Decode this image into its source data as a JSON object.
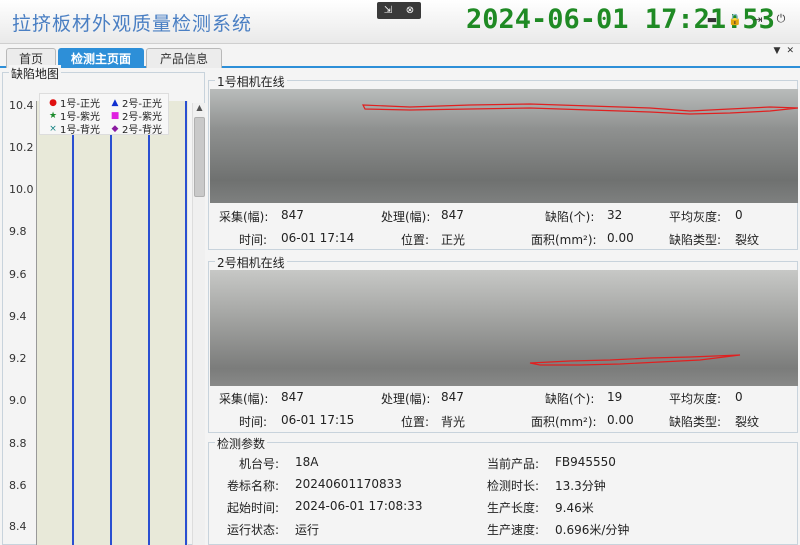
{
  "app": {
    "title": "拉挤板材外观质量检测系统",
    "clock": "2024-06-01 17:21:53"
  },
  "tabs": [
    {
      "label": "首页",
      "active": false
    },
    {
      "label": "检测主页面",
      "active": true
    },
    {
      "label": "产品信息",
      "active": false
    }
  ],
  "defect_map": {
    "title": "缺陷地图",
    "y_ticks": [
      "10.4",
      "10.2",
      "10.0",
      "9.8",
      "9.6",
      "9.4",
      "9.2",
      "9.0",
      "8.8",
      "8.6",
      "8.4"
    ],
    "legend": [
      {
        "label": "1号-正光",
        "marker": "●",
        "color": "#e01010"
      },
      {
        "label": "2号-正光",
        "marker": "▲",
        "color": "#1030d0"
      },
      {
        "label": "1号-紫光",
        "marker": "★",
        "color": "#1a8a2a"
      },
      {
        "label": "2号-紫光",
        "marker": "■",
        "color": "#e020e0"
      },
      {
        "label": "1号-背光",
        "marker": "×",
        "color": "#108080"
      },
      {
        "label": "2号-背光",
        "marker": "◆",
        "color": "#8a1aa0"
      }
    ]
  },
  "camera1": {
    "title": "1号相机在线",
    "collect_label": "采集(幅):",
    "collect_value": "847",
    "process_label": "处理(幅):",
    "process_value": "847",
    "defect_label": "缺陷(个):",
    "defect_value": "32",
    "gray_label": "平均灰度:",
    "gray_value": "0",
    "time_label": "时间:",
    "time_value": "06-01 17:14",
    "pos_label": "位置:",
    "pos_value": "正光",
    "area_label": "面积(mm²):",
    "area_value": "0.00",
    "type_label": "缺陷类型:",
    "type_value": "裂纹"
  },
  "camera2": {
    "title": "2号相机在线",
    "collect_label": "采集(幅):",
    "collect_value": "847",
    "process_label": "处理(幅):",
    "process_value": "847",
    "defect_label": "缺陷(个):",
    "defect_value": "19",
    "gray_label": "平均灰度:",
    "gray_value": "0",
    "time_label": "时间:",
    "time_value": "06-01 17:15",
    "pos_label": "位置:",
    "pos_value": "背光",
    "area_label": "面积(mm²):",
    "area_value": "0.00",
    "type_label": "缺陷类型:",
    "type_value": "裂纹"
  },
  "params": {
    "title": "检测参数",
    "machine_label": "机台号:",
    "machine_value": "18A",
    "product_label": "当前产品:",
    "product_value": "FB945550",
    "roll_label": "卷标名称:",
    "roll_value": "20240601170833",
    "duration_label": "检测时长:",
    "duration_value": "13.3分钟",
    "start_label": "起始时间:",
    "start_value": "2024-06-01 17:08:33",
    "length_label": "生产长度:",
    "length_value": "9.46米",
    "status_label": "运行状态:",
    "status_value": "运行",
    "speed_label": "生产速度:",
    "speed_value": "0.696米/分钟"
  },
  "colors": {
    "accent": "#2d8fd8",
    "clock": "#1f8a24",
    "crack": "#e02020",
    "lane": "#2a4fd1"
  }
}
